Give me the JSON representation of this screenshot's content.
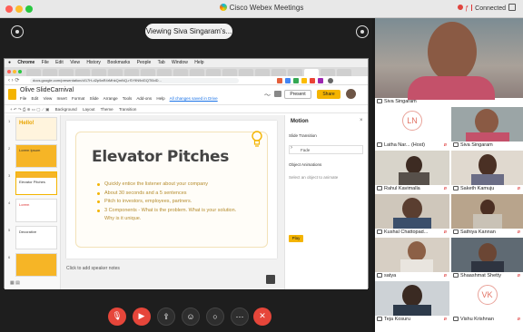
{
  "window": {
    "title": "Cisco Webex Meetings",
    "status": "Connected"
  },
  "share": {
    "viewing_label": "Viewing Siva Singaram's..."
  },
  "browser": {
    "mac_menu": [
      "Chrome",
      "File",
      "Edit",
      "View",
      "History",
      "Bookmarks",
      "People",
      "Tab",
      "Window",
      "Help"
    ],
    "url": "docs.google.com/presentation/d/17H-d2p9aR4rMhkQmNQ-rSY9N9dGQTl0dD..."
  },
  "slides_app": {
    "doc_title": "Olive SlideCarnival",
    "menu": [
      "File",
      "Edit",
      "View",
      "Insert",
      "Format",
      "Slide",
      "Arrange",
      "Tools",
      "Add-ons",
      "Help"
    ],
    "saved_link": "All changes saved in Drive",
    "present_label": "Present",
    "share_label": "Share",
    "toolbar": [
      "Background",
      "Layout",
      "Theme",
      "Transition"
    ],
    "notes_placeholder": "Click to add speaker notes"
  },
  "filmstrip": {
    "thumbs": [
      {
        "num": "1",
        "text": "Hello!"
      },
      {
        "num": "2",
        "text": "Lorem Ipsum"
      },
      {
        "num": "3",
        "text": "Elevator Pitches"
      },
      {
        "num": "4",
        "text": "Lorem"
      },
      {
        "num": "5",
        "text": "Decorative"
      },
      {
        "num": "6",
        "text": ""
      }
    ]
  },
  "slide": {
    "title": "Elevator Pitches",
    "bullets": [
      "Quickly entice the listener about your company",
      "About 30 seconds and a 5 sentences",
      "Pitch to investors, employees, partners.",
      "3 Components - What is the problem. What is your solution. Why is it unique."
    ]
  },
  "motion_panel": {
    "header": "Motion",
    "slide_transition_label": "Slide Transition",
    "transition_value": "Fade",
    "object_animations_label": "Object Animations",
    "select_object_hint": "Select an object to animate",
    "play_label": "Play"
  },
  "participants": [
    {
      "name": "Siva Singaram",
      "initials": "",
      "muted": false
    },
    {
      "name": "Latha Nar... (Host)",
      "initials": "LN",
      "muted": true
    },
    {
      "name": "Siva Singaram",
      "initials": "",
      "muted": true
    },
    {
      "name": "Rahul Kavimalla",
      "initials": "",
      "muted": true
    },
    {
      "name": "Saketh Kamuju",
      "initials": "",
      "muted": true
    },
    {
      "name": "Kushal Chattopad...",
      "initials": "",
      "muted": true
    },
    {
      "name": "Sathiya Kannan",
      "initials": "",
      "muted": true
    },
    {
      "name": "satya",
      "initials": "",
      "muted": true
    },
    {
      "name": "Shaashmat Shetty",
      "initials": "",
      "muted": true
    },
    {
      "name": "Teja Kosuru",
      "initials": "",
      "muted": true
    },
    {
      "name": "Vishu Krishnan",
      "initials": "VK",
      "muted": true
    }
  ],
  "controls": [
    "mute-button",
    "stop-video-button",
    "share-button",
    "participants-button",
    "chat-button",
    "more-button",
    "leave-button"
  ],
  "colors": {
    "accent_yellow": "#f4b400",
    "leave_red": "#e6463a",
    "slide_bullet_text": "#b58c2e"
  }
}
